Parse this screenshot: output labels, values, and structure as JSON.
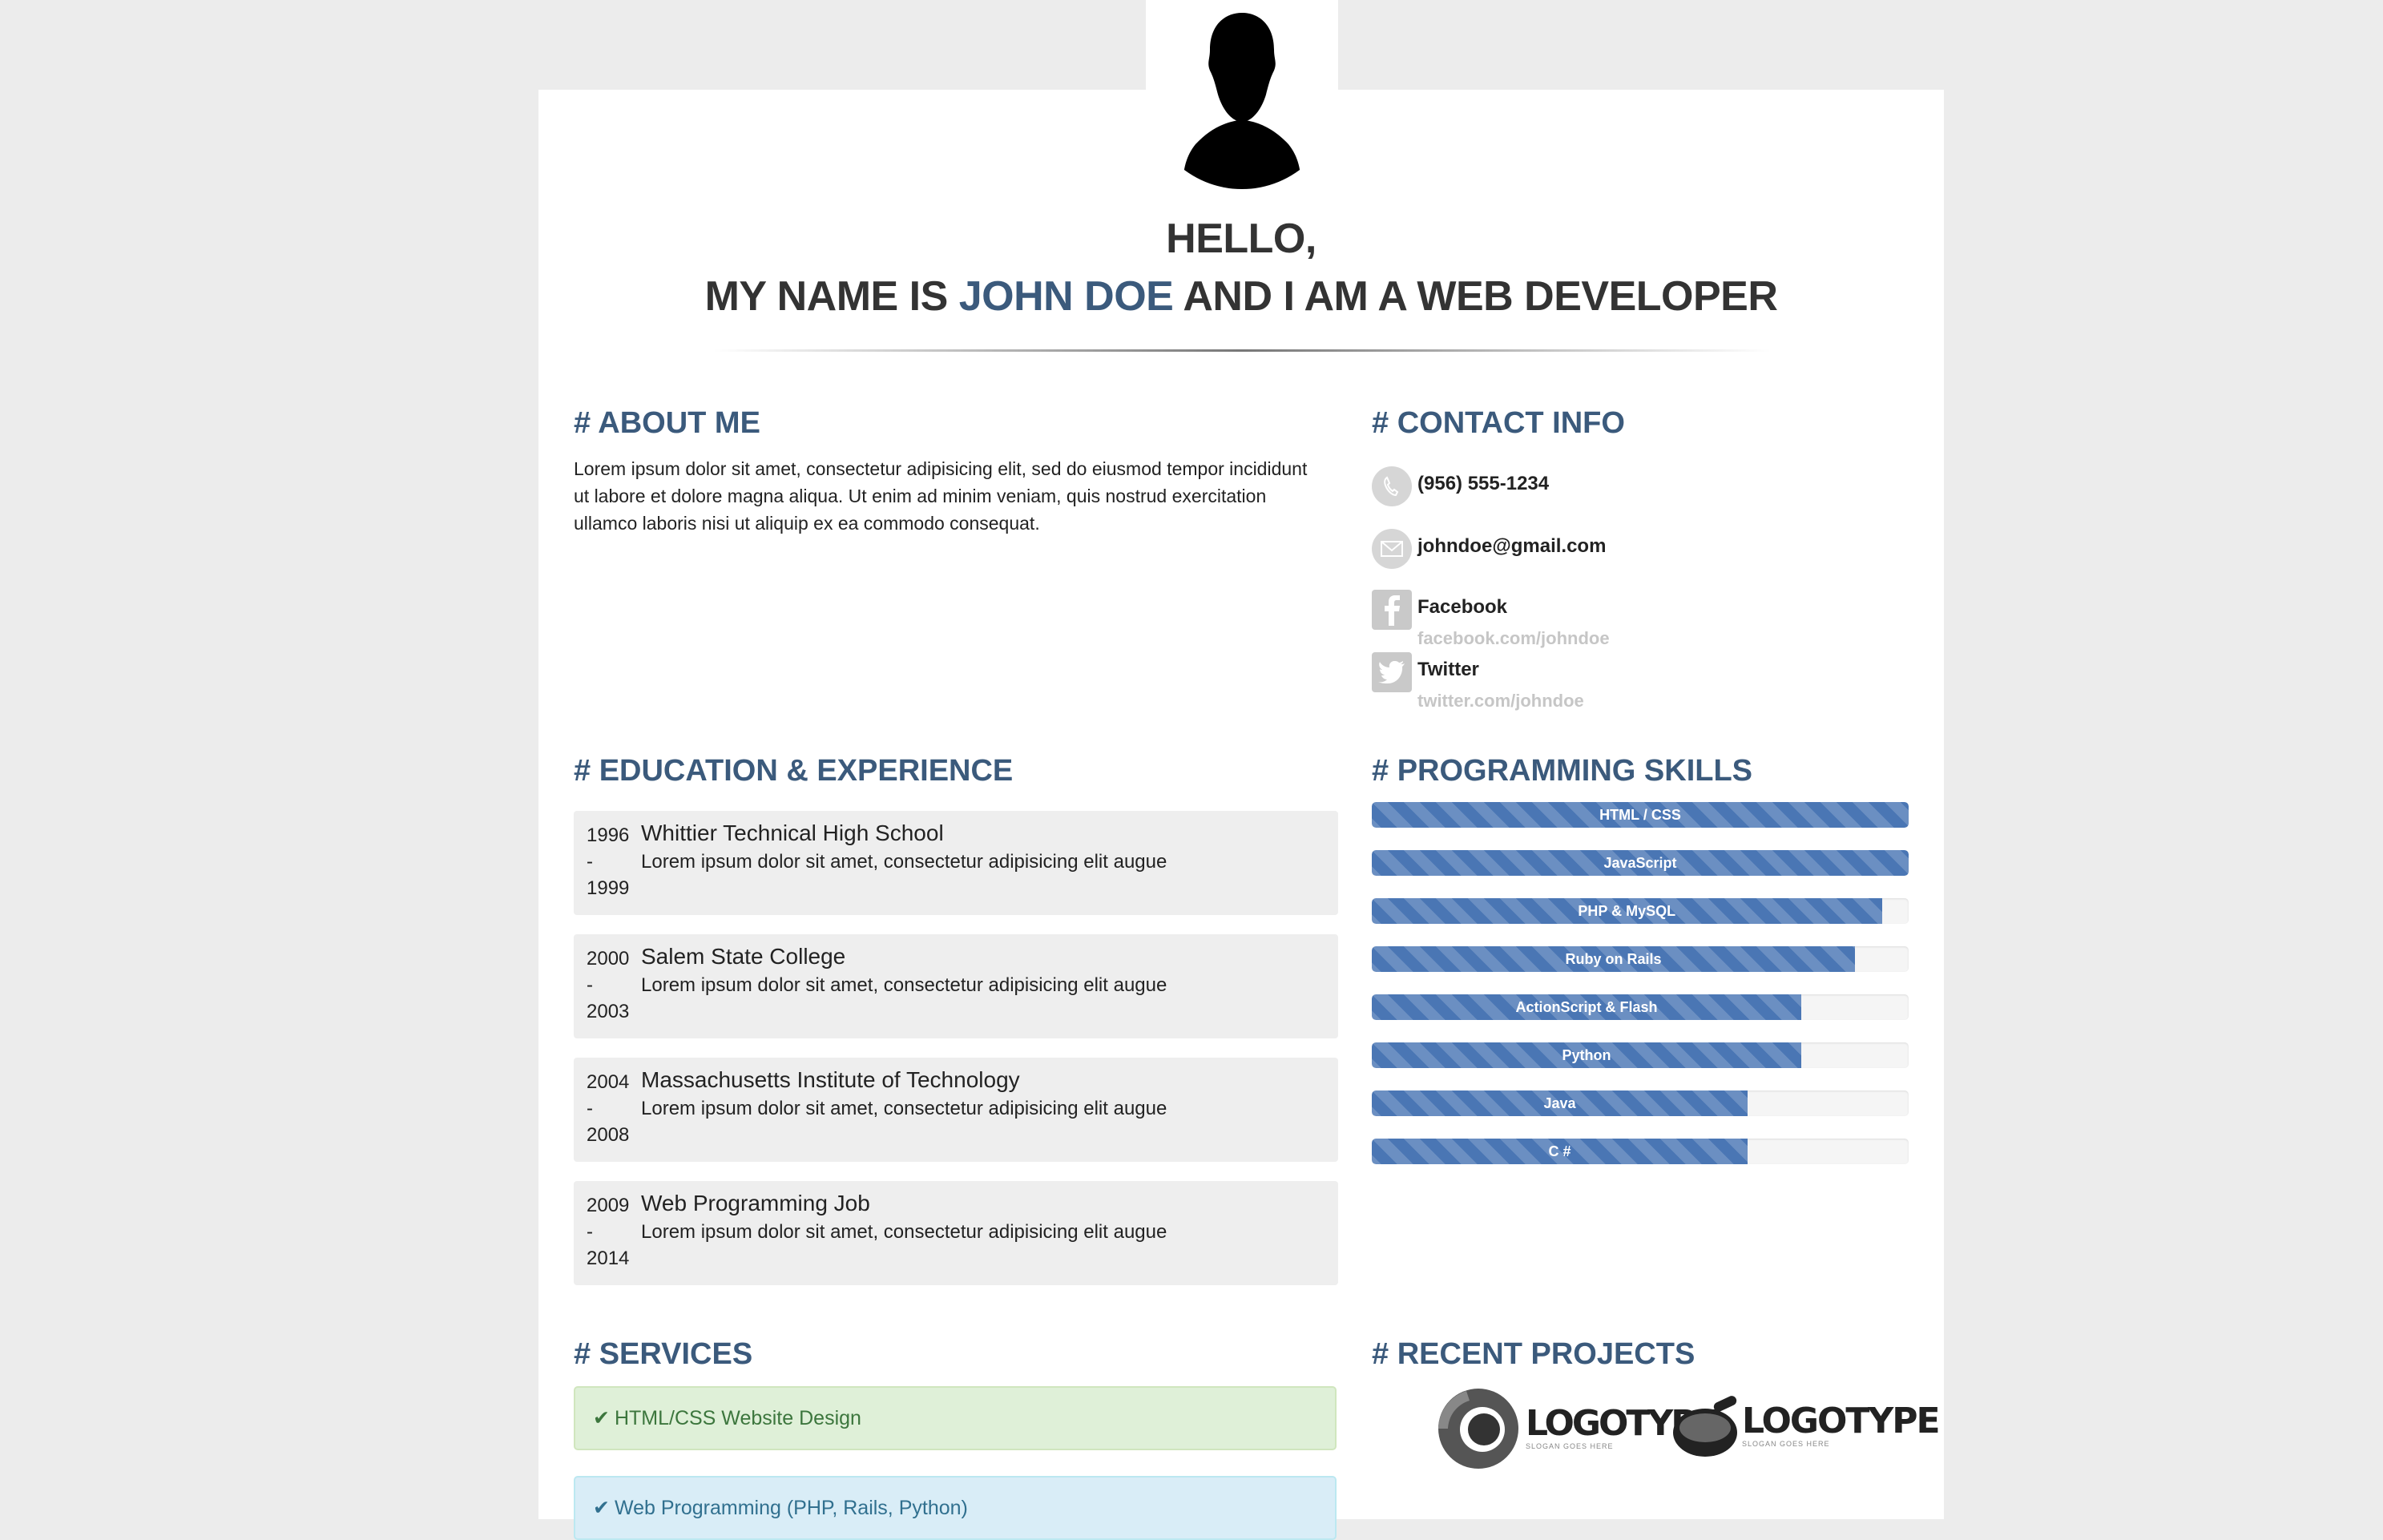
{
  "header": {
    "greeting": "HELLO,",
    "intro_prefix": "MY NAME IS",
    "name": "JOHN DOE",
    "intro_suffix": "AND I AM A WEB DEVELOPER"
  },
  "about": {
    "title": "# ABOUT ME",
    "text": "Lorem ipsum dolor sit amet, consectetur adipisicing elit, sed do eiusmod tempor incididunt ut labore et dolore magna aliqua. Ut enim ad minim veniam, quis nostrud exercitation ullamco laboris nisi ut aliquip ex ea commodo consequat."
  },
  "contact": {
    "title": "# CONTACT INFO",
    "phone": "(956) 555-1234",
    "email": "johndoe@gmail.com",
    "facebook_label": "Facebook",
    "facebook_url": "facebook.com/johndoe",
    "twitter_label": "Twitter",
    "twitter_url": "twitter.com/johndoe"
  },
  "education": {
    "title": "# EDUCATION & EXPERIENCE",
    "items": [
      {
        "start": "1996",
        "dash": "-",
        "end": "1999",
        "school": "Whittier Technical High School",
        "desc": "Lorem ipsum dolor sit amet, consectetur adipisicing elit augue"
      },
      {
        "start": "2000",
        "dash": "-",
        "end": "2003",
        "school": "Salem State College",
        "desc": "Lorem ipsum dolor sit amet, consectetur adipisicing elit augue"
      },
      {
        "start": "2004",
        "dash": "-",
        "end": "2008",
        "school": "Massachusetts Institute of Technology",
        "desc": "Lorem ipsum dolor sit amet, consectetur adipisicing elit augue"
      },
      {
        "start": "2009",
        "dash": "-",
        "end": "2014",
        "school": "Web Programming Job",
        "desc": "Lorem ipsum dolor sit amet, consectetur adipisicing elit augue"
      }
    ]
  },
  "skills": {
    "title": "# PROGRAMMING SKILLS",
    "items": [
      {
        "name": "HTML / CSS",
        "level": 100
      },
      {
        "name": "JavaScript",
        "level": 100
      },
      {
        "name": "PHP & MySQL",
        "level": 95
      },
      {
        "name": "Ruby on Rails",
        "level": 90
      },
      {
        "name": "ActionScript & Flash",
        "level": 80
      },
      {
        "name": "Python",
        "level": 80
      },
      {
        "name": "Java",
        "level": 70
      },
      {
        "name": "C #",
        "level": 70
      }
    ],
    "bar_color": "#4a76b4"
  },
  "services": {
    "title": "# SERVICES",
    "items": [
      {
        "label": "HTML/CSS Website Design"
      },
      {
        "label": "Web Programming (PHP, Rails, Python)"
      }
    ]
  },
  "projects": {
    "title": "# RECENT PROJECTS",
    "logos": [
      {
        "text": "LOGOTYPE",
        "slogan": "SLOGAN GOES HERE"
      },
      {
        "text": "LOGOTYPE",
        "slogan": "SLOGAN GOES HERE"
      }
    ]
  },
  "colors": {
    "accent": "#3b5a7c",
    "page_bg": "#ececec",
    "card_bg": "#ffffff"
  }
}
